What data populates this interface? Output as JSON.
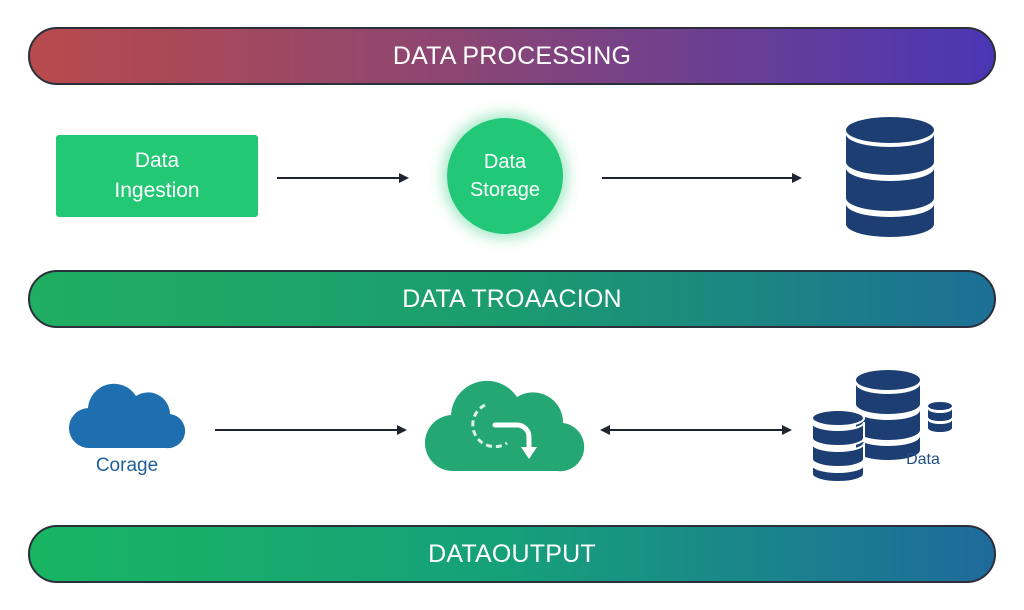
{
  "banners": {
    "top": "DATA PROCESSING",
    "middle": "DATA TROAACION",
    "bottom": "DATAOUTPUT"
  },
  "nodes": {
    "ingestion": {
      "line1": "Data",
      "line2": "Ingestion"
    },
    "storage": {
      "line1": "Data",
      "line2": "Storage"
    },
    "database_icon": "database-icon",
    "cloud_storage": {
      "label": "Corage",
      "icon": "cloud-icon"
    },
    "cloud_transform": {
      "icon": "cloud-transfer-icon"
    },
    "data_stack": {
      "label": "Data",
      "icon": "database-stack-icon"
    }
  },
  "colors": {
    "green": "#22c874",
    "navy": "#1d3e73",
    "cloud_blue": "#1f6eb0",
    "cloud_green": "#24a773"
  }
}
